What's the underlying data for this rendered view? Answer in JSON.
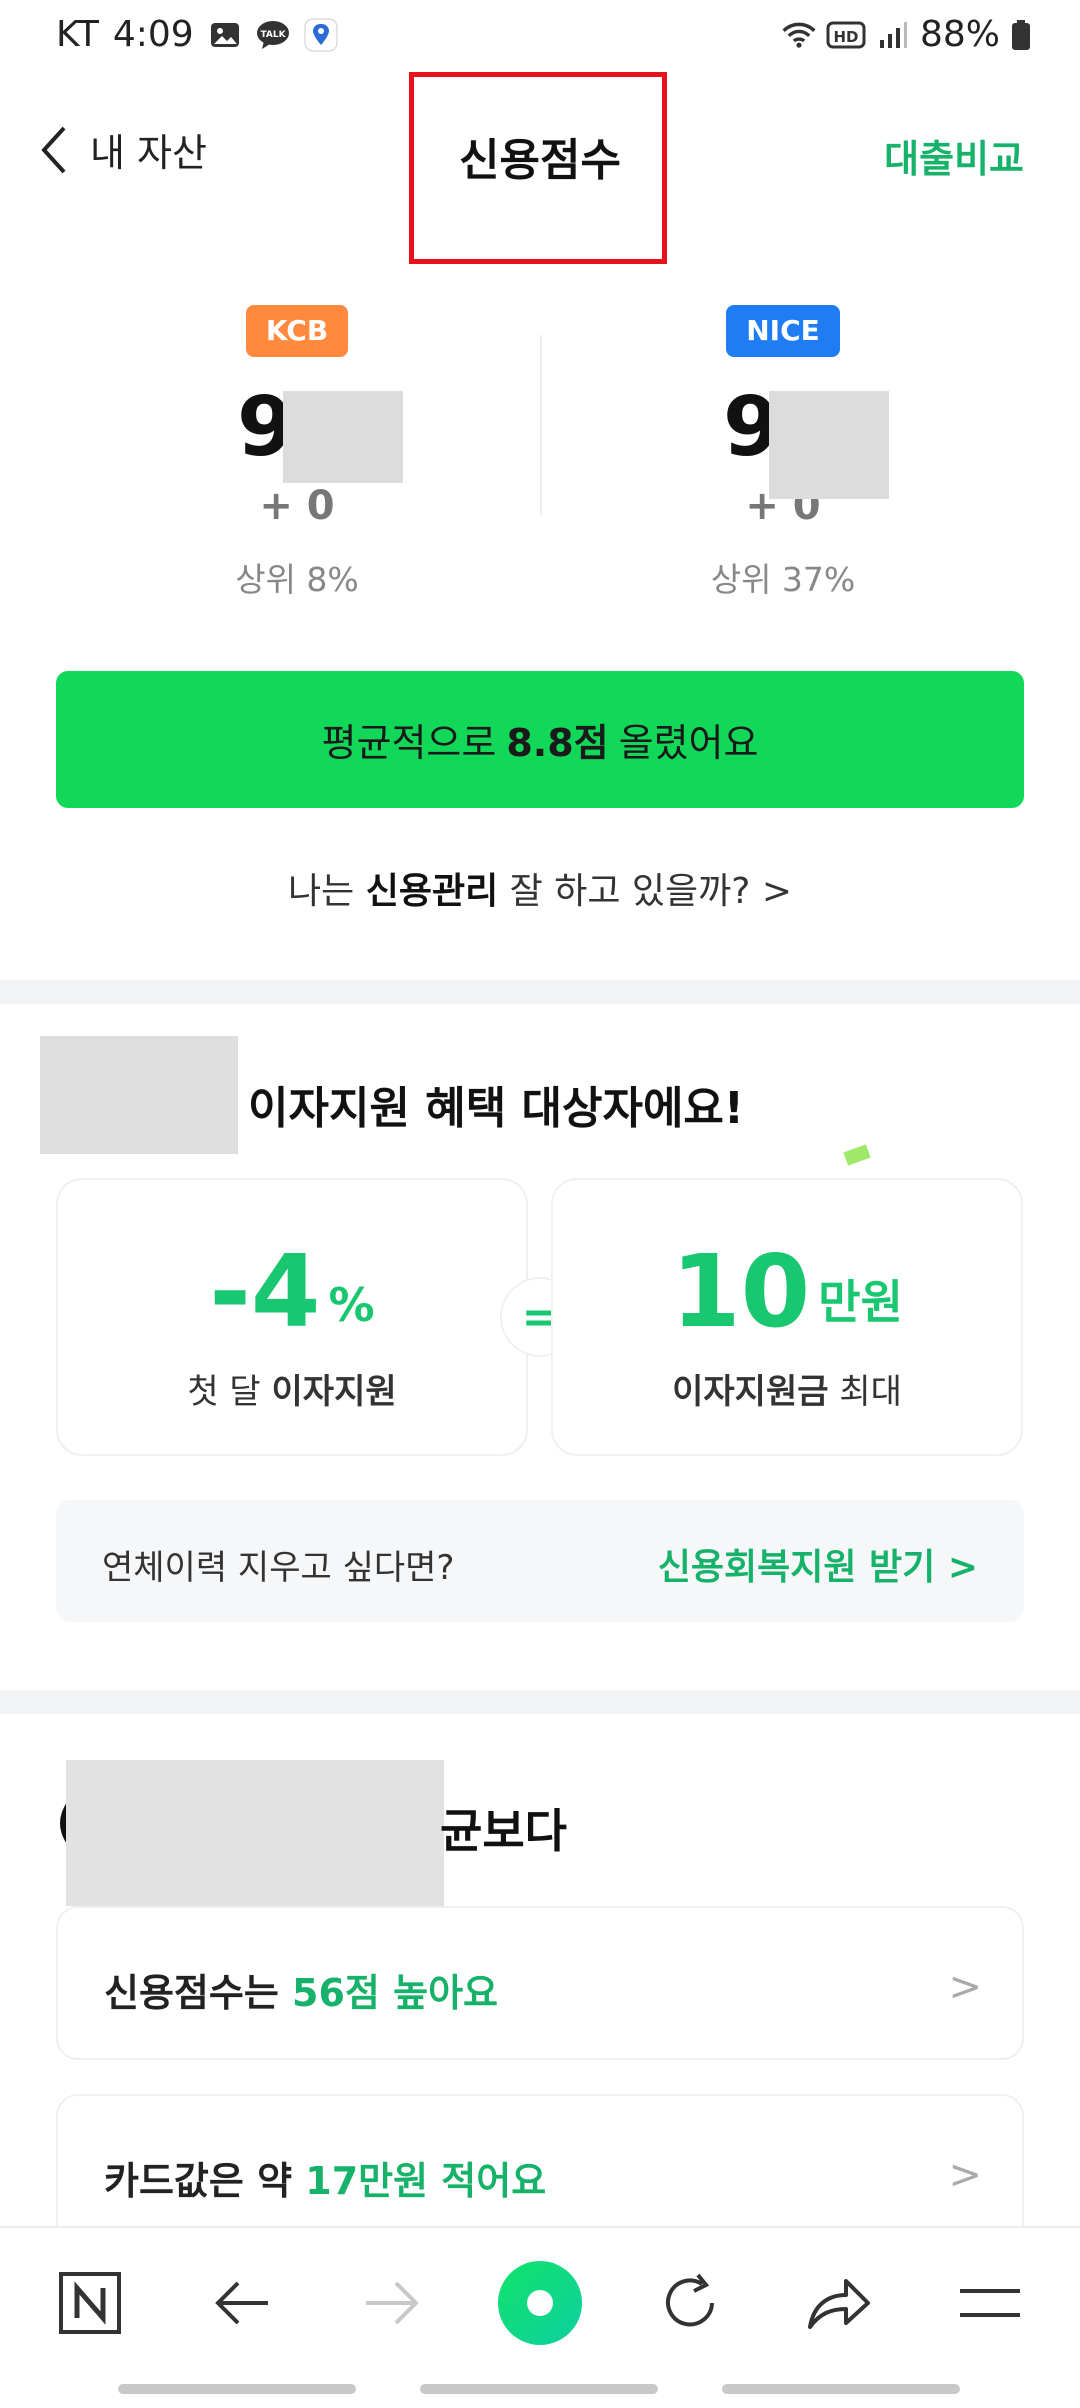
{
  "status_bar": {
    "carrier": "KT",
    "time": "4:09",
    "battery": "88%",
    "hd": "HD"
  },
  "header": {
    "back_label": "내 자산",
    "title": "신용점수",
    "action": "대출비교"
  },
  "scores": [
    {
      "agency": "KCB",
      "score_visible": "98",
      "change": "+ 0",
      "rank": "상위 8%"
    },
    {
      "agency": "NICE",
      "score_visible": "97",
      "change": "+ 0",
      "rank": "상위 37%"
    }
  ],
  "cta": {
    "prefix": "평균적으로",
    "value": "8.8점",
    "suffix": "올렸어요"
  },
  "credit_link": {
    "prefix": "나는",
    "bold": "신용관리",
    "suffix": "잘 하고 있을까?",
    "chevron": ">"
  },
  "promo": {
    "title": "이자지원 혜택 대상자에요!",
    "left": {
      "big": "-4",
      "unit": "%",
      "caption_plain": "첫 달",
      "caption_bold": "이자지원"
    },
    "equals": "=",
    "right": {
      "big": "10",
      "unit": "만원",
      "caption_bold": "이자지원금",
      "caption_plain": "최대"
    }
  },
  "recovery": {
    "question": "연체이력 지우고 싶다면?",
    "link": "신용회복지원 받기",
    "chevron": ">"
  },
  "comparison": {
    "title_visible": "균보다",
    "title_lead": "(",
    "items": [
      {
        "prefix": "신용점수는",
        "highlight": "56점 높아요",
        "chevron": ">"
      },
      {
        "prefix": "카드값은 약",
        "highlight": "17만원 적어요",
        "chevron": ">"
      }
    ]
  },
  "colors": {
    "accent": "#17b26a",
    "cta": "#12d859",
    "kcb": "#ff8a3d",
    "nice": "#1f7cf2",
    "highlight_box": "#e8111b"
  }
}
